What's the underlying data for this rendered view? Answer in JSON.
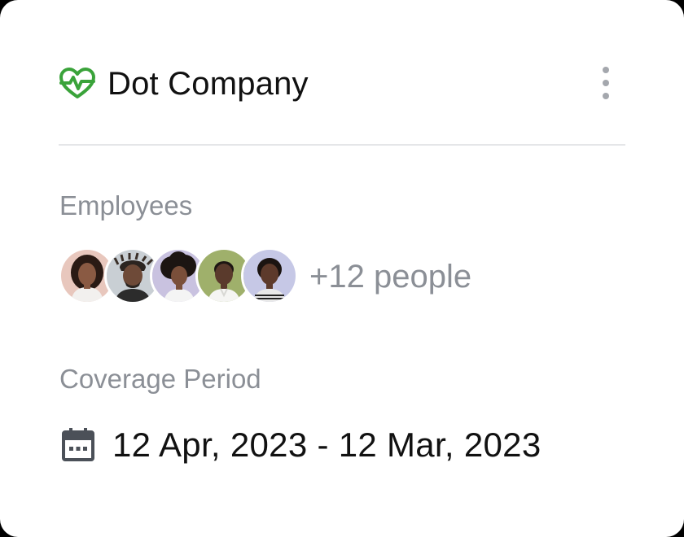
{
  "company": {
    "name": "Dot Company",
    "icon": "heart-pulse-icon",
    "icon_color": "#3aa33a"
  },
  "employees": {
    "label": "Employees",
    "more_people": "+12 people",
    "avatars": [
      {
        "name": "avatar-1",
        "bg": "#e8c7bd"
      },
      {
        "name": "avatar-2",
        "bg": "#c9cfd4"
      },
      {
        "name": "avatar-3",
        "bg": "#c9c2e0"
      },
      {
        "name": "avatar-4",
        "bg": "#9fb06b"
      },
      {
        "name": "avatar-5",
        "bg": "#c6c8e6"
      }
    ]
  },
  "coverage": {
    "label": "Coverage Period",
    "dates": "12 Apr, 2023 - 12 Mar, 2023",
    "icon": "calendar-icon"
  },
  "colors": {
    "accent": "#3aa33a",
    "muted_text": "#8b8f96",
    "primary_text": "#111111",
    "divider": "#e5e6e8"
  }
}
